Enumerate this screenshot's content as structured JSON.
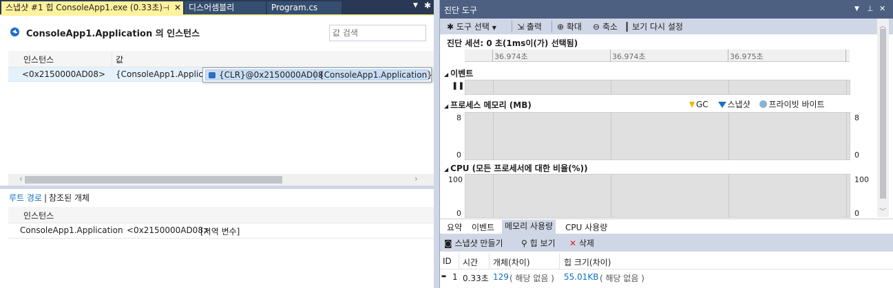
{
  "left_tabs": {
    "snapshot": "스냅샷 #1 힙 ConsoleApp1.exe (0.33초)",
    "disassembly": "디스어셈블리",
    "program": "Program.cs"
  },
  "instances_view": {
    "title": "ConsoleApp1.Application 의 인스턴스",
    "search_placeholder": "값 검색",
    "columns": [
      "인스턴스",
      "값"
    ],
    "row": {
      "instance": "<0x2150000AD08>",
      "value": "{ConsoleApp1.Application"
    },
    "tooltip": {
      "name": "{CLR}@0x2150000AD08",
      "value": "{ConsoleApp1.Application}"
    }
  },
  "paths": {
    "tab_root": "루트 경로",
    "tab_separator": "|",
    "tab_referenced": "참조된 개체",
    "column": "인스턴스",
    "row": {
      "type": "ConsoleApp1.Application",
      "instance": "<0x2150000AD08>",
      "note": "[지역 변수]"
    }
  },
  "diag": {
    "title": "진단 도구",
    "toolbar": {
      "select_tools": "도구 선택",
      "output": "출력",
      "zoom_in": "확대",
      "zoom_out": "축소",
      "reset_view": "보기 다시 설정"
    },
    "session": "진단 세션: 0 초(1ms이(가) 선택됨)",
    "ruler_labels": [
      "36.974초",
      "36.974초",
      "36.975초"
    ],
    "events_label": "이벤트",
    "memory_label": "프로세스 메모리 (MB)",
    "legend": {
      "gc": "GC",
      "snapshot": "스냅샷",
      "private_bytes": "프라이빗 바이트"
    },
    "memory_axis": {
      "top": "8",
      "bottom": "0"
    },
    "cpu_label": "CPU (모든 프로세서에 대한 비율(%))",
    "cpu_axis": {
      "top": "100",
      "bottom": "0"
    },
    "bottom_tabs": [
      "요약",
      "이벤트",
      "메모리 사용량",
      "CPU 사용량"
    ],
    "snapshot_toolbar": {
      "take": "스냅샷 만들기",
      "view_heap": "힙 보기",
      "delete": "삭제"
    },
    "snapshot_columns": [
      "ID",
      "시간",
      "개체(차이)",
      "힙 크기(차이)"
    ],
    "snapshot_row": {
      "id": "1",
      "time": "0.33초",
      "objects": "129",
      "objects_diff": "( 해당 없음 )",
      "heap_size": "55.01KB",
      "heap_diff": "( 해당 없음 )"
    }
  }
}
